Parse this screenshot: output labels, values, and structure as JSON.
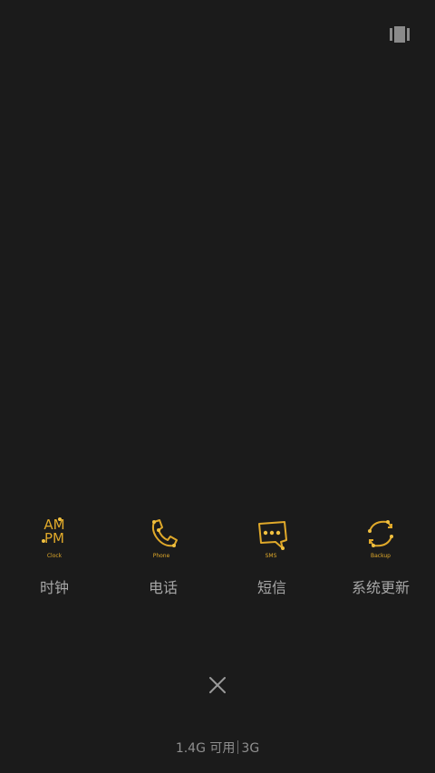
{
  "screen": {
    "background": "#1b1b1b",
    "top_icon": "multi-window-icon"
  },
  "recents": {
    "accent_color": "#e0a92a",
    "apps": [
      {
        "label": "时钟",
        "icon": "clock-icon",
        "icon_text": [
          "AM",
          "PM",
          "Clock"
        ]
      },
      {
        "label": "电话",
        "icon": "phone-icon",
        "icon_text": "Phone"
      },
      {
        "label": "短信",
        "icon": "sms-icon",
        "icon_text": "SMS"
      },
      {
        "label": "系统更新",
        "icon": "backup-icon",
        "icon_text": "Backup"
      }
    ]
  },
  "footer": {
    "close_icon": "close-icon",
    "memory_free": "1.4G 可用",
    "memory_total": "3G"
  }
}
